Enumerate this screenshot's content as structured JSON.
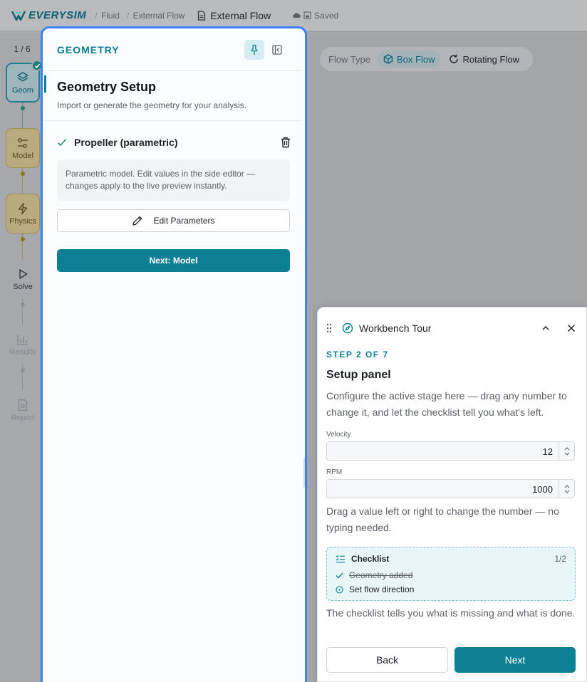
{
  "topbar": {
    "logo_text": "EVERYSIM",
    "breadcrumb": [
      "Fluid",
      "External Flow"
    ],
    "breadcrumb_sep": "/",
    "doc_title": "External Flow",
    "save_status": "Saved"
  },
  "rail": {
    "step_count": "1 / 6",
    "stages": [
      {
        "label": "Geom",
        "icon": "layers-icon"
      },
      {
        "label": "Model",
        "icon": "sliders-icon"
      },
      {
        "label": "Physics",
        "icon": "lightning-icon"
      },
      {
        "label": "Solve",
        "icon": "play-icon"
      },
      {
        "label": "Results",
        "icon": "bar-chart-icon"
      },
      {
        "label": "Report",
        "icon": "document-icon"
      }
    ]
  },
  "panel": {
    "label": "GEOMETRY",
    "title": "Geometry Setup",
    "subtitle": "Import or generate the geometry for your analysis.",
    "item_name": "Propeller (parametric)",
    "info": "Parametric model. Edit values in the side editor — changes apply to the live preview instantly.",
    "edit_button": "Edit Parameters",
    "next_button": "Next: Model"
  },
  "flow_type": {
    "label": "Flow Type",
    "options": [
      "Box Flow",
      "Rotating Flow"
    ],
    "selected": "Box Flow"
  },
  "tour": {
    "title": "Workbench Tour",
    "step": "STEP 2 OF 7",
    "heading": "Setup panel",
    "description": "Configure the active stage here — drag any number to change it, and let the checklist tell you what's left.",
    "fields": [
      {
        "label": "Velocity",
        "value": "12"
      },
      {
        "label": "RPM",
        "value": "1000"
      }
    ],
    "hint": "Drag a value left or right to change the number — no typing needed.",
    "checklist": {
      "title": "Checklist",
      "count": "1/2",
      "items": [
        {
          "label": "Geometry added",
          "done": true
        },
        {
          "label": "Set flow direction",
          "done": false
        }
      ]
    },
    "footer_hint": "The checklist tells you what is missing and what is done.",
    "back_button": "Back",
    "next_button": "Next"
  },
  "colors": {
    "accent": "#0d7f95",
    "highlight_border": "#3a82f7",
    "success": "#1d9b58"
  }
}
